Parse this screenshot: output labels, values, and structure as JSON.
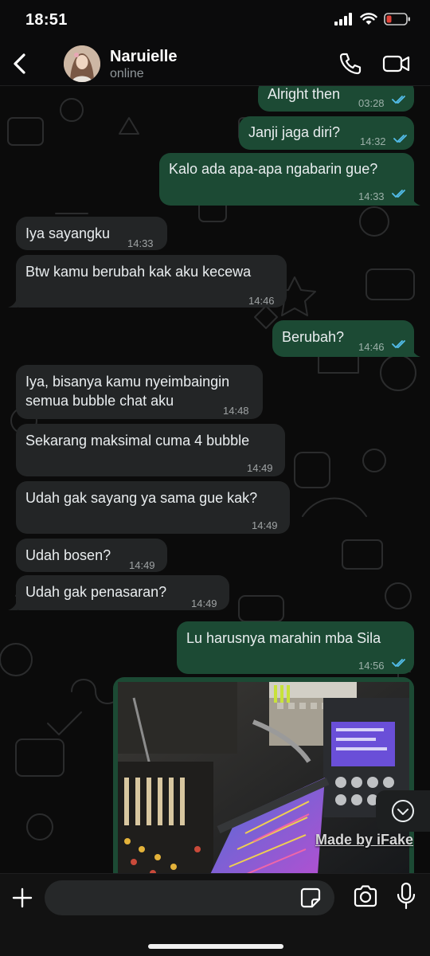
{
  "status_bar": {
    "time": "18:51"
  },
  "header": {
    "contact_name": "Naruielle",
    "contact_status": "online"
  },
  "icons": {
    "back": "chevron-left-icon",
    "voice_call": "phone-icon",
    "video_call": "video-camera-icon",
    "attach": "plus-icon",
    "sticker": "sticker-icon",
    "camera": "camera-icon",
    "mic": "microphone-icon",
    "scroll": "chevron-down-circle-icon"
  },
  "messages": [
    {
      "text": "Alright then",
      "time": "03:28",
      "dir": "out"
    },
    {
      "text": "Janji jaga diri?",
      "time": "14:32",
      "dir": "out"
    },
    {
      "text": "Kalo ada apa-apa ngabarin gue?",
      "time": "14:33",
      "dir": "out"
    },
    {
      "text": "Iya sayangku",
      "time": "14:33",
      "dir": "in"
    },
    {
      "text": "Btw kamu berubah kak aku kecewa",
      "time": "14:46",
      "dir": "in"
    },
    {
      "text": "Berubah?",
      "time": "14:46",
      "dir": "out"
    },
    {
      "text": "Iya, bisanya kamu nyeimbaingin\nsemua bubble chat aku",
      "time": "14:48",
      "dir": "in"
    },
    {
      "text": "Sekarang maksimal cuma 4 bubble",
      "time": "14:49",
      "dir": "in"
    },
    {
      "text": "Udah gak sayang ya sama gue kak?",
      "time": "14:49",
      "dir": "in"
    },
    {
      "text": "Udah bosen?",
      "time": "14:49",
      "dir": "in"
    },
    {
      "text": "Udah gak penasaran?",
      "time": "14:49",
      "dir": "in"
    },
    {
      "text": "Lu harusnya marahin mba Sila",
      "time": "14:56",
      "dir": "out"
    }
  ],
  "watermark": "Made by iFake",
  "input": {
    "placeholder": "",
    "value": ""
  },
  "colors": {
    "incoming_bubble": "#232526",
    "outgoing_bubble": "#1c4a34",
    "read_ticks": "#53bdeb",
    "background": "#0b0b0b"
  }
}
